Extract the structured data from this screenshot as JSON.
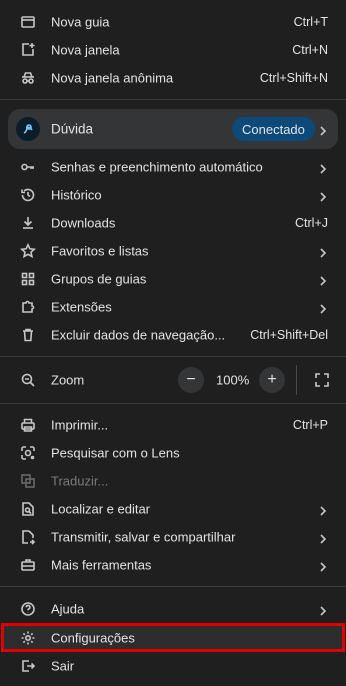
{
  "menu": {
    "new_tab": {
      "label": "Nova guia",
      "shortcut": "Ctrl+T"
    },
    "new_window": {
      "label": "Nova janela",
      "shortcut": "Ctrl+N"
    },
    "incognito": {
      "label": "Nova janela anônima",
      "shortcut": "Ctrl+Shift+N"
    },
    "profile": {
      "name": "Dúvida",
      "status": "Conectado"
    },
    "passwords": {
      "label": "Senhas e preenchimento automático"
    },
    "history": {
      "label": "Histórico"
    },
    "downloads": {
      "label": "Downloads",
      "shortcut": "Ctrl+J"
    },
    "bookmarks": {
      "label": "Favoritos e listas"
    },
    "tab_groups": {
      "label": "Grupos de guias"
    },
    "extensions": {
      "label": "Extensões"
    },
    "clear_data": {
      "label": "Excluir dados de navegação...",
      "shortcut": "Ctrl+Shift+Del"
    },
    "zoom": {
      "label": "Zoom",
      "minus": "−",
      "value": "100%",
      "plus": "+"
    },
    "print": {
      "label": "Imprimir...",
      "shortcut": "Ctrl+P"
    },
    "lens": {
      "label": "Pesquisar com o Lens"
    },
    "translate": {
      "label": "Traduzir..."
    },
    "find_edit": {
      "label": "Localizar e editar"
    },
    "cast_save_share": {
      "label": "Transmitir, salvar e compartilhar"
    },
    "more_tools": {
      "label": "Mais ferramentas"
    },
    "help": {
      "label": "Ajuda"
    },
    "settings": {
      "label": "Configurações"
    },
    "exit": {
      "label": "Sair"
    }
  },
  "colors": {
    "background": "#1f1f1f",
    "highlight_border": "#e00000",
    "connected_pill": "#0d4a7a"
  }
}
